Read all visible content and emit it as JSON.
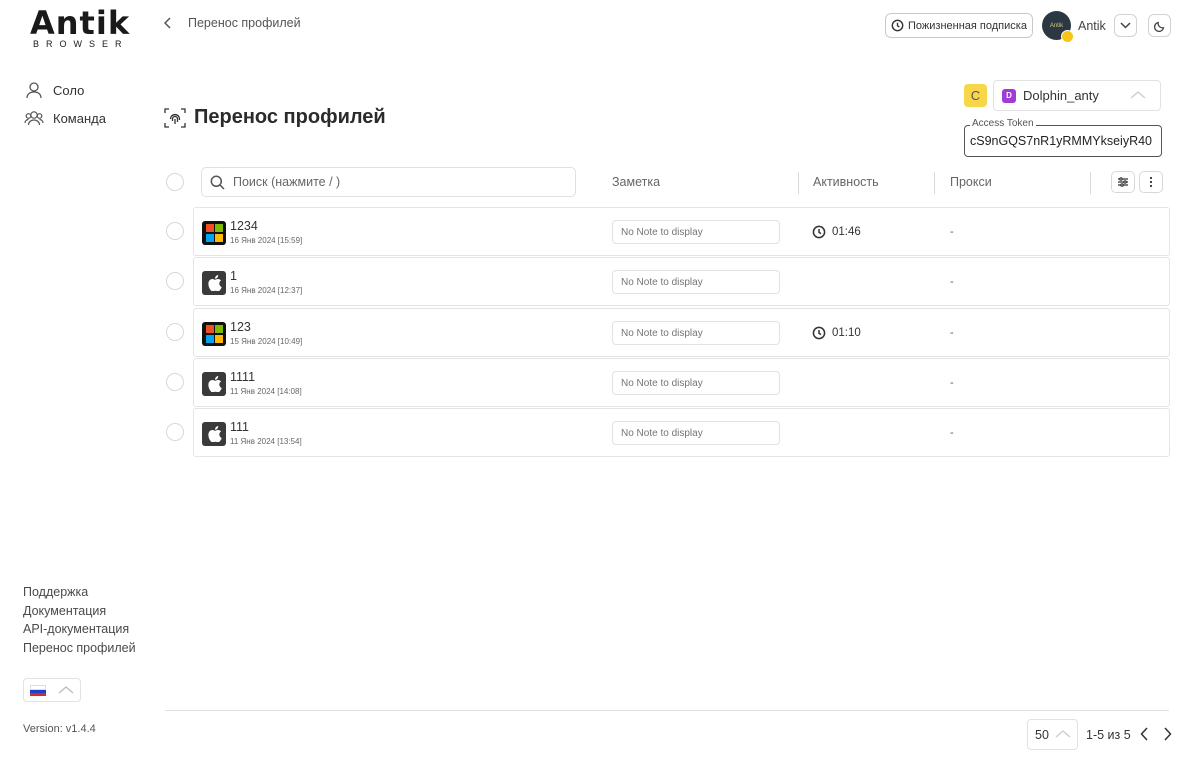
{
  "brand": {
    "logo_main": "Antik",
    "logo_sub": "BROWSER"
  },
  "sidebar": {
    "nav": [
      {
        "label": "Соло",
        "icon": "user-icon"
      },
      {
        "label": "Команда",
        "icon": "team-icon"
      }
    ],
    "links": [
      "Поддержка",
      "Документация",
      "API-документация",
      "Перенос профилей"
    ],
    "language": "ru",
    "version": "Version: v1.4.4"
  },
  "header": {
    "breadcrumb": "Перенос профилей",
    "subscription": "Пожизненная подписка",
    "user_name": "Antik",
    "avatar_text": "Antik"
  },
  "page": {
    "title": "Перенос профилей",
    "source": "Dolphin_anty",
    "refresh_label": "C",
    "token_label": "Access Token",
    "token_value": "cS9nGQS7nR1yRMMYkseiyR40"
  },
  "table": {
    "search_placeholder": "Поиск (нажмите / )",
    "columns": {
      "note": "Заметка",
      "activity": "Активность",
      "proxy": "Прокси"
    },
    "note_placeholder": "No Note to display",
    "rows": [
      {
        "name": "1234",
        "date": "16 Янв 2024 [15:59]",
        "os": "windows",
        "activity": "01:46",
        "proxy": "-"
      },
      {
        "name": "1",
        "date": "16 Янв 2024 [12:37]",
        "os": "mac",
        "activity": "",
        "proxy": "-"
      },
      {
        "name": "123",
        "date": "15 Янв 2024 [10:49]",
        "os": "windows",
        "activity": "01:10",
        "proxy": "-"
      },
      {
        "name": "1111",
        "date": "11 Янв 2024 [14:08]",
        "os": "mac",
        "activity": "",
        "proxy": "-"
      },
      {
        "name": "111",
        "date": "11 Янв 2024 [13:54]",
        "os": "mac",
        "activity": "",
        "proxy": "-"
      }
    ]
  },
  "pagination": {
    "per_page": "50",
    "info": "1-5 из 5"
  },
  "colors": {
    "accent_yellow": "#f7d648",
    "dolphin_purple": "#a23ad8"
  }
}
